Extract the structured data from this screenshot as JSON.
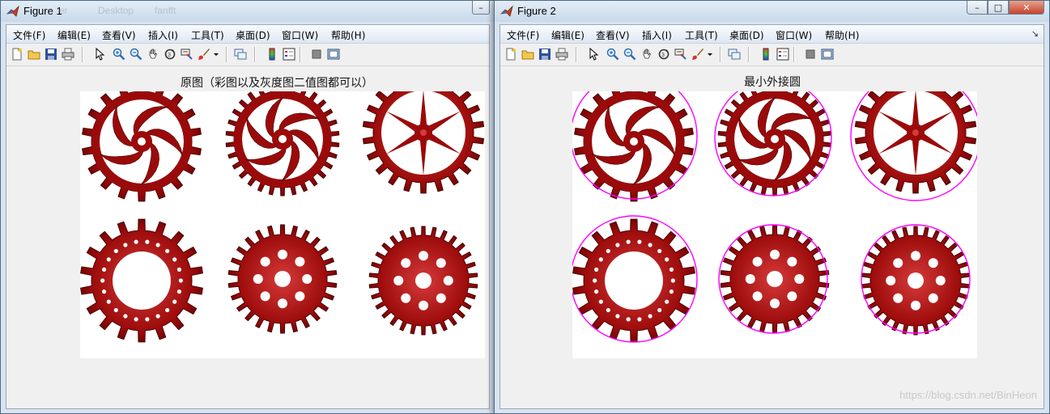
{
  "figure1": {
    "title": "Figure 1",
    "plot_title": "原图（彩图以及灰度图二值图都可以）",
    "ghost_path": [
      "er",
      "Desktop",
      "fanfft"
    ]
  },
  "figure2": {
    "title": "Figure 2",
    "plot_title": "最小外接圆"
  },
  "window_controls": {
    "minimize": "–",
    "maximize": "□",
    "close": "✕"
  },
  "menu": [
    "文件(F)",
    "编辑(E)",
    "查看(V)",
    "插入(I)",
    "工具(T)",
    "桌面(D)",
    "窗口(W)",
    "帮助(H)"
  ],
  "menu_overflow": "↘",
  "toolbar_icons": [
    "new-figure-icon",
    "open-file-icon",
    "save-icon",
    "print-icon",
    "select-arrow-icon",
    "zoom-in-icon",
    "zoom-out-icon",
    "pan-icon",
    "rotate-3d-icon",
    "data-cursor-icon",
    "brush-icon",
    "brush-dropdown-icon",
    "link-plot-icon",
    "colorbar-icon",
    "legend-icon",
    "hide-plot-tools-icon",
    "show-plot-tools-icon"
  ],
  "colors": {
    "gear": "#9b0a0a",
    "gear_dark": "#4a0000",
    "gear_light": "#d63a3a",
    "circle": "#ff00ff",
    "window_frame": "#d8e4f1"
  },
  "watermark": "https://blog.csdn.net/BinHeon"
}
